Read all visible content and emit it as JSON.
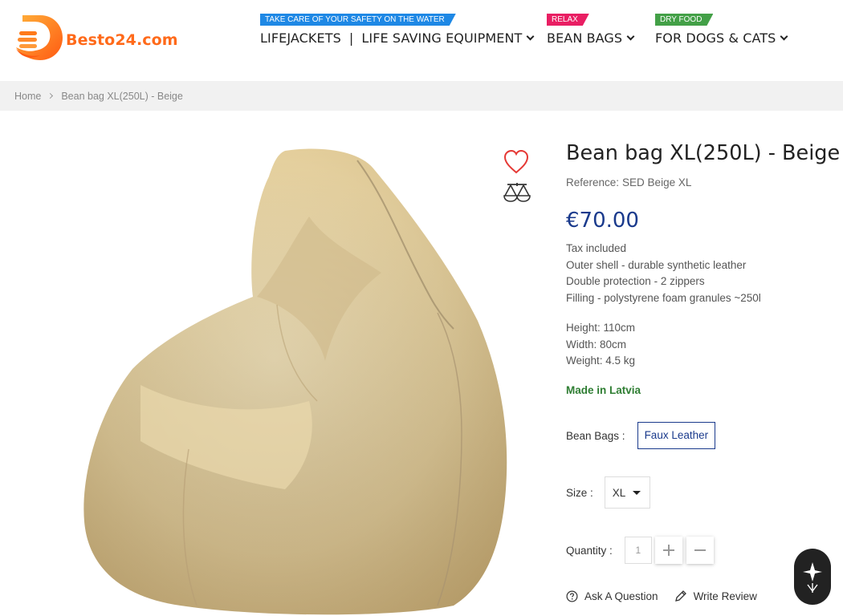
{
  "header": {
    "logo_text": "Besto24.com",
    "nav": [
      {
        "badge": "TAKE CARE OF YOUR SAFETY ON THE WATER",
        "badge_color": "#1e88e5",
        "label_a": "LIFEJACKETS",
        "separator": "|",
        "label_b": "LIFE SAVING EQUIPMENT"
      },
      {
        "badge": "RELAX",
        "badge_color": "#e91e63",
        "label": "BEAN BAGS"
      },
      {
        "badge": "DRY FOOD",
        "badge_color": "#43a047",
        "label": "FOR DOGS & CATS"
      }
    ]
  },
  "breadcrumb": {
    "home": "Home",
    "current": "Bean bag XL(250L) - Beige"
  },
  "product": {
    "title": "Bean bag XL(250L) - Beige",
    "reference_label": "Reference:",
    "reference_value": "SED Beige XL",
    "price": "€70.00",
    "description": [
      "Tax included",
      "Outer shell - durable synthetic leather",
      "Double protection - 2 zippers",
      "Filling - polystyrene foam granules ~250l"
    ],
    "dimensions": [
      "Height: 110cm",
      "Width: 80cm",
      "Weight: 4.5 kg"
    ],
    "origin": "Made in Latvia",
    "variant_label": "Bean Bags :",
    "variant_value": "Faux Leather",
    "size_label": "Size :",
    "size_value": "XL",
    "quantity_label": "Quantity :",
    "quantity_value": "1",
    "ask_question": "Ask A Question",
    "write_review": "Write Review"
  },
  "colors": {
    "brand_orange": "#ff6a1a",
    "price_blue": "#1a3a8c",
    "made_green": "#2e7d32",
    "favorite_red": "#e53935"
  },
  "icons": [
    "heart-icon",
    "compare-scale-icon",
    "question-circle-icon",
    "pencil-icon",
    "plus-icon",
    "minus-icon",
    "chat-widget-icon"
  ]
}
